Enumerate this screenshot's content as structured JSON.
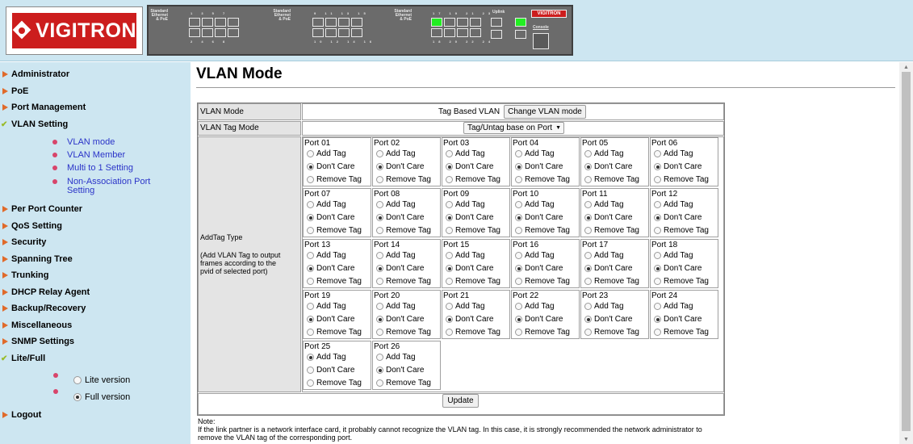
{
  "header": {
    "logo_text": "VIGITRON",
    "device": {
      "label_std": "Standard\nEthernet\n& PoE",
      "brand": "VIGITRON",
      "uplink_label": "Uplink",
      "console_label": "Console",
      "top_nums_1": "1 3 5 7",
      "bottom_nums_1": "2 4 6 8",
      "top_nums_2": "9 11 13 15",
      "bottom_nums_2": "10 12 14 16",
      "top_nums_3": "17 19 21 23",
      "bottom_nums_3": "18 20 22 24"
    }
  },
  "sidebar": {
    "items": [
      {
        "label": "Administrator"
      },
      {
        "label": "PoE"
      },
      {
        "label": "Port Management"
      },
      {
        "label": "VLAN Setting"
      },
      {
        "label": "Per Port Counter"
      },
      {
        "label": "QoS Setting"
      },
      {
        "label": "Security"
      },
      {
        "label": "Spanning Tree"
      },
      {
        "label": "Trunking"
      },
      {
        "label": "DHCP Relay Agent"
      },
      {
        "label": "Backup/Recovery"
      },
      {
        "label": "Miscellaneous"
      },
      {
        "label": "SNMP Settings"
      },
      {
        "label": "Lite/Full"
      },
      {
        "label": "Logout"
      }
    ],
    "vlan_sub": [
      {
        "label": "VLAN mode"
      },
      {
        "label": "VLAN Member"
      },
      {
        "label": "Multi to 1 Setting"
      },
      {
        "label": "Non-Association Port Setting"
      }
    ],
    "lite_full": [
      {
        "label": "Lite version",
        "checked": false
      },
      {
        "label": "Full version",
        "checked": true
      }
    ]
  },
  "main": {
    "title": "VLAN Mode",
    "vlan_mode_label": "VLAN Mode",
    "vlan_mode_value": "Tag Based VLAN",
    "change_button": "Change VLAN mode",
    "tag_mode_label": "VLAN Tag Mode",
    "tag_mode_value": "Tag/Untag base on Port",
    "addtag_title": "AddTag Type",
    "addtag_desc": "(Add VLAN Tag to output frames according to the pvid of selected port)",
    "options": [
      "Add Tag",
      "Don't Care",
      "Remove Tag"
    ],
    "ports": [
      {
        "name": "Port 01",
        "selected": 1
      },
      {
        "name": "Port 02",
        "selected": 1
      },
      {
        "name": "Port 03",
        "selected": 1
      },
      {
        "name": "Port 04",
        "selected": 1
      },
      {
        "name": "Port 05",
        "selected": 1
      },
      {
        "name": "Port 06",
        "selected": 1
      },
      {
        "name": "Port 07",
        "selected": 1
      },
      {
        "name": "Port 08",
        "selected": 1
      },
      {
        "name": "Port 09",
        "selected": 1
      },
      {
        "name": "Port 10",
        "selected": 1
      },
      {
        "name": "Port 11",
        "selected": 1
      },
      {
        "name": "Port 12",
        "selected": 1
      },
      {
        "name": "Port 13",
        "selected": 1
      },
      {
        "name": "Port 14",
        "selected": 1
      },
      {
        "name": "Port 15",
        "selected": 1
      },
      {
        "name": "Port 16",
        "selected": 1
      },
      {
        "name": "Port 17",
        "selected": 1
      },
      {
        "name": "Port 18",
        "selected": 1
      },
      {
        "name": "Port 19",
        "selected": 1
      },
      {
        "name": "Port 20",
        "selected": 1
      },
      {
        "name": "Port 21",
        "selected": 1
      },
      {
        "name": "Port 22",
        "selected": 1
      },
      {
        "name": "Port 23",
        "selected": 1
      },
      {
        "name": "Port 24",
        "selected": 1
      },
      {
        "name": "Port 25",
        "selected": 0
      },
      {
        "name": "Port 26",
        "selected": 1
      }
    ],
    "update_button": "Update",
    "note_title": "Note:",
    "note_text": "If the link partner is a network interface card, it probably cannot recognize the VLAN tag. In this case, it is strongly recommended the network administrator to remove the VLAN tag of the corresponding port."
  }
}
